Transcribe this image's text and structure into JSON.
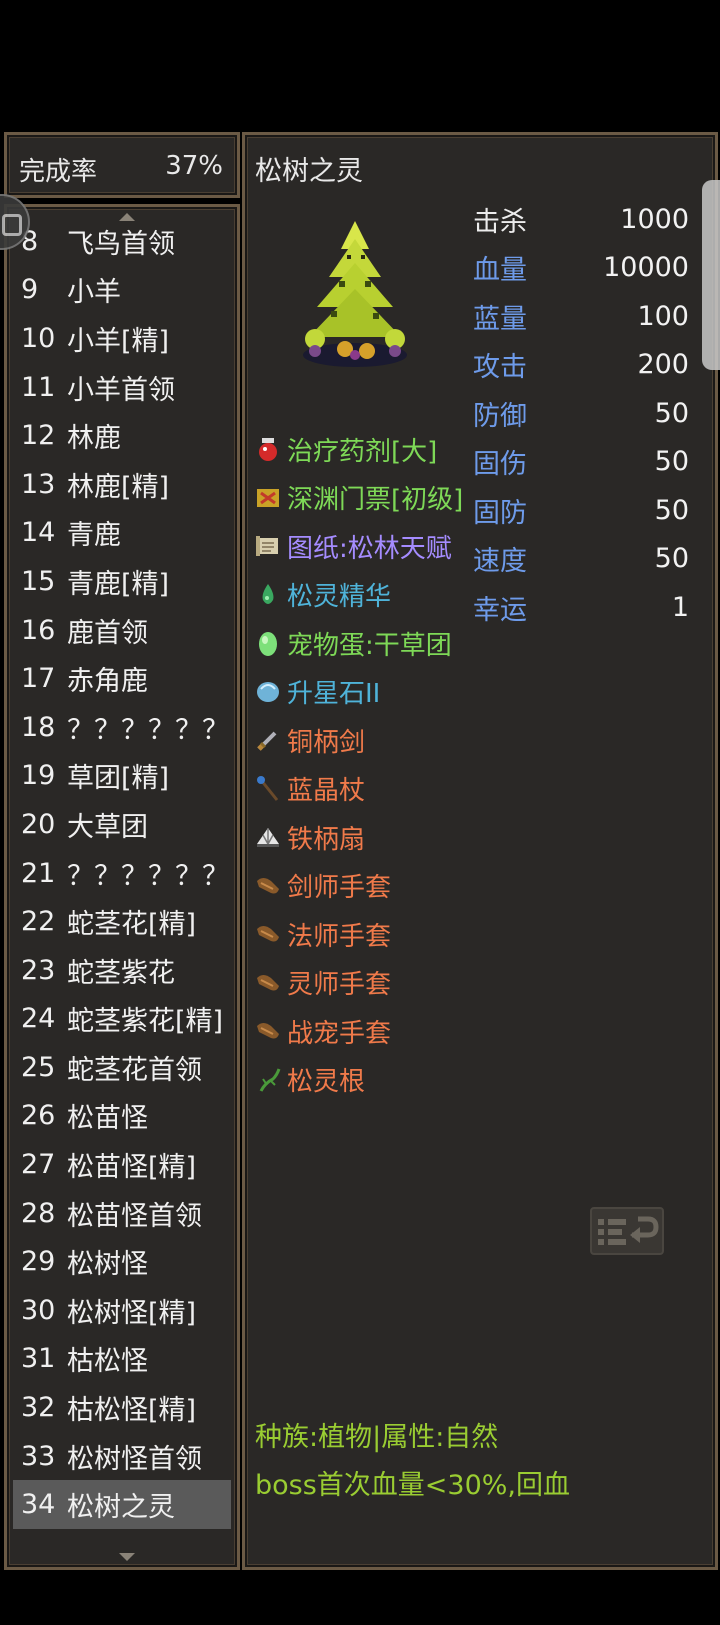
{
  "completion": {
    "label": "完成率",
    "value": "37%"
  },
  "monster_list": [
    {
      "num": "8",
      "name": "飞鸟首领"
    },
    {
      "num": "9",
      "name": "小羊"
    },
    {
      "num": "10",
      "name": "小羊[精]"
    },
    {
      "num": "11",
      "name": "小羊首领"
    },
    {
      "num": "12",
      "name": "林鹿"
    },
    {
      "num": "13",
      "name": "林鹿[精]"
    },
    {
      "num": "14",
      "name": "青鹿"
    },
    {
      "num": "15",
      "name": "青鹿[精]"
    },
    {
      "num": "16",
      "name": "鹿首领"
    },
    {
      "num": "17",
      "name": "赤角鹿"
    },
    {
      "num": "18",
      "name": "？？？？？？"
    },
    {
      "num": "19",
      "name": "草团[精]"
    },
    {
      "num": "20",
      "name": "大草团"
    },
    {
      "num": "21",
      "name": "？？？？？？"
    },
    {
      "num": "22",
      "name": "蛇茎花[精]"
    },
    {
      "num": "23",
      "name": "蛇茎紫花"
    },
    {
      "num": "24",
      "name": "蛇茎紫花[精]"
    },
    {
      "num": "25",
      "name": "蛇茎花首领"
    },
    {
      "num": "26",
      "name": "松苗怪"
    },
    {
      "num": "27",
      "name": "松苗怪[精]"
    },
    {
      "num": "28",
      "name": "松苗怪首领"
    },
    {
      "num": "29",
      "name": "松树怪"
    },
    {
      "num": "30",
      "name": "松树怪[精]"
    },
    {
      "num": "31",
      "name": "枯松怪"
    },
    {
      "num": "32",
      "name": "枯松怪[精]"
    },
    {
      "num": "33",
      "name": "松树怪首领"
    },
    {
      "num": "34",
      "name": "松树之灵"
    }
  ],
  "selected_index": 26,
  "detail": {
    "title": "松树之灵",
    "stats": [
      {
        "label": "击杀",
        "value": "1000"
      },
      {
        "label": "血量",
        "value": "10000"
      },
      {
        "label": "蓝量",
        "value": "100"
      },
      {
        "label": "攻击",
        "value": "200"
      },
      {
        "label": "防御",
        "value": "50"
      },
      {
        "label": "固伤",
        "value": "50"
      },
      {
        "label": "固防",
        "value": "50"
      },
      {
        "label": "速度",
        "value": "50"
      },
      {
        "label": "幸运",
        "value": "1"
      }
    ],
    "drops": [
      {
        "name": "治疗药剂[大]",
        "color": "#7ed957",
        "icon": "potion-icon"
      },
      {
        "name": "深渊门票[初级]",
        "color": "#7ed957",
        "icon": "ticket-icon"
      },
      {
        "name": "图纸:松林天赋",
        "color": "#a58cff",
        "icon": "scroll-icon"
      },
      {
        "name": "松灵精华",
        "color": "#4fb3d9",
        "icon": "essence-icon"
      },
      {
        "name": "宠物蛋:干草团",
        "color": "#7ed957",
        "icon": "egg-icon"
      },
      {
        "name": "升星石II",
        "color": "#4fb3d9",
        "icon": "star-stone-icon"
      },
      {
        "name": "铜柄剑",
        "color": "#f07a4a",
        "icon": "sword-icon"
      },
      {
        "name": "蓝晶杖",
        "color": "#f07a4a",
        "icon": "staff-icon"
      },
      {
        "name": "铁柄扇",
        "color": "#f07a4a",
        "icon": "fan-icon"
      },
      {
        "name": "剑师手套",
        "color": "#f07a4a",
        "icon": "glove-icon"
      },
      {
        "name": "法师手套",
        "color": "#f07a4a",
        "icon": "glove-icon"
      },
      {
        "name": "灵师手套",
        "color": "#f07a4a",
        "icon": "glove-icon"
      },
      {
        "name": "战宠手套",
        "color": "#f07a4a",
        "icon": "glove-icon"
      },
      {
        "name": "松灵根",
        "color": "#f07a4a",
        "icon": "root-icon"
      }
    ],
    "race_info": "种族:植物|属性:自然",
    "boss_info": "boss首次血量<30%,回血"
  }
}
